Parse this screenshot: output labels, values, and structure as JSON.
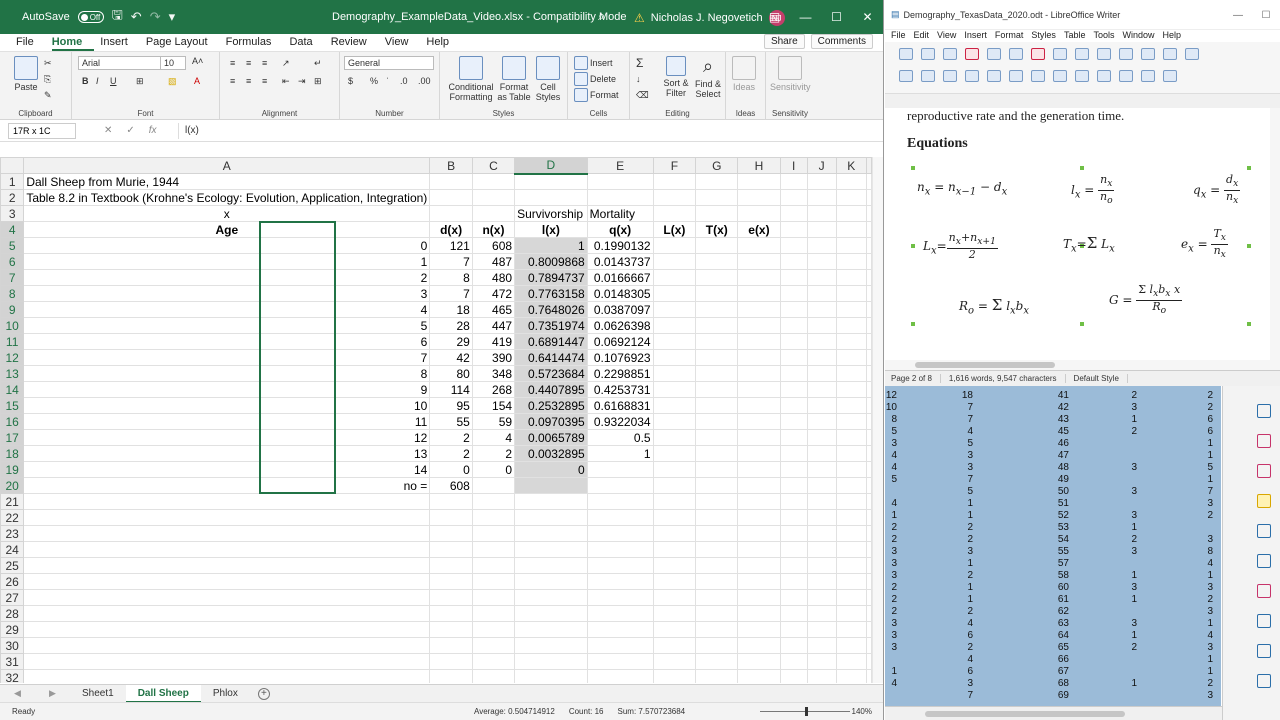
{
  "excel": {
    "autosave_label": "AutoSave",
    "autosave_state": "Off",
    "title": "Demography_ExampleData_Video.xlsx  -  Compatibility Mode",
    "user": "Nicholas J. Negovetich",
    "user_initials": "NJ",
    "menu": [
      "File",
      "Home",
      "Insert",
      "Page Layout",
      "Formulas",
      "Data",
      "Review",
      "View",
      "Help"
    ],
    "active_tab": "Home",
    "share": "Share",
    "comments": "Comments",
    "ribbon": {
      "paste": "Paste",
      "clipboard": "Clipboard",
      "font_name": "Arial",
      "font_size": "10",
      "font": "Font",
      "alignment": "Alignment",
      "number_format": "General",
      "number": "Number",
      "conditional": "Conditional Formatting",
      "format_table": "Format as Table",
      "cell_styles": "Cell Styles",
      "styles": "Styles",
      "insert": "Insert",
      "delete": "Delete",
      "format": "Format",
      "cells": "Cells",
      "sort": "Sort & Filter",
      "find": "Find & Select",
      "editing": "Editing",
      "ideas_btn": "Ideas",
      "ideas": "Ideas",
      "sensitivity_btn": "Sensitivity",
      "sensitivity": "Sensitivity"
    },
    "name_box": "17R x 1C",
    "formula": "l(x)",
    "columns": [
      "A",
      "B",
      "C",
      "D",
      "E",
      "F",
      "G",
      "H",
      "I",
      "J",
      "K"
    ],
    "rows": [
      [
        "Dall Sheep from Murie, 1944",
        "",
        "",
        "",
        "",
        "",
        "",
        "",
        "",
        "",
        ""
      ],
      [
        "Table 8.2 in Textbook (Krohne's Ecology: Evolution, Application, Integration)",
        "",
        "",
        "",
        "",
        "",
        "",
        "",
        "",
        "",
        ""
      ],
      [
        "x",
        "",
        "",
        "Survivorship",
        "Mortality",
        "",
        "",
        "",
        "",
        "",
        ""
      ],
      [
        "Age",
        "d(x)",
        "n(x)",
        "l(x)",
        "q(x)",
        "L(x)",
        "T(x)",
        "e(x)",
        "",
        "",
        ""
      ],
      [
        "0",
        "121",
        "608",
        "1",
        "0.1990132",
        "",
        "",
        "",
        "",
        "",
        ""
      ],
      [
        "1",
        "7",
        "487",
        "0.8009868",
        "0.0143737",
        "",
        "",
        "",
        "",
        "",
        ""
      ],
      [
        "2",
        "8",
        "480",
        "0.7894737",
        "0.0166667",
        "",
        "",
        "",
        "",
        "",
        ""
      ],
      [
        "3",
        "7",
        "472",
        "0.7763158",
        "0.0148305",
        "",
        "",
        "",
        "",
        "",
        ""
      ],
      [
        "4",
        "18",
        "465",
        "0.7648026",
        "0.0387097",
        "",
        "",
        "",
        "",
        "",
        ""
      ],
      [
        "5",
        "28",
        "447",
        "0.7351974",
        "0.0626398",
        "",
        "",
        "",
        "",
        "",
        ""
      ],
      [
        "6",
        "29",
        "419",
        "0.6891447",
        "0.0692124",
        "",
        "",
        "",
        "",
        "",
        ""
      ],
      [
        "7",
        "42",
        "390",
        "0.6414474",
        "0.1076923",
        "",
        "",
        "",
        "",
        "",
        ""
      ],
      [
        "8",
        "80",
        "348",
        "0.5723684",
        "0.2298851",
        "",
        "",
        "",
        "",
        "",
        ""
      ],
      [
        "9",
        "114",
        "268",
        "0.4407895",
        "0.4253731",
        "",
        "",
        "",
        "",
        "",
        ""
      ],
      [
        "10",
        "95",
        "154",
        "0.2532895",
        "0.6168831",
        "",
        "",
        "",
        "",
        "",
        ""
      ],
      [
        "11",
        "55",
        "59",
        "0.0970395",
        "0.9322034",
        "",
        "",
        "",
        "",
        "",
        ""
      ],
      [
        "12",
        "2",
        "4",
        "0.0065789",
        "0.5",
        "",
        "",
        "",
        "",
        "",
        ""
      ],
      [
        "13",
        "2",
        "2",
        "0.0032895",
        "1",
        "",
        "",
        "",
        "",
        "",
        ""
      ],
      [
        "14",
        "0",
        "0",
        "0",
        "",
        "",
        "",
        "",
        "",
        "",
        ""
      ],
      [
        "no =",
        "608",
        "",
        "",
        "",
        "",
        "",
        "",
        "",
        "",
        ""
      ]
    ],
    "total_rows": 32,
    "sheet_tabs": [
      "Sheet1",
      "Dall Sheep",
      "Phlox"
    ],
    "active_sheet": "Dall Sheep",
    "status": {
      "ready": "Ready",
      "average": "Average: 0.504714912",
      "count": "Count: 16",
      "sum": "Sum: 7.570723684",
      "zoom": "140%"
    }
  },
  "writer": {
    "title": "Demography_TexasData_2020.odt - LibreOffice Writer",
    "menu": [
      "File",
      "Edit",
      "View",
      "Insert",
      "Format",
      "Styles",
      "Table",
      "Tools",
      "Window",
      "Help"
    ],
    "cut_text": "reproductive rate and the generation time.",
    "heading": "Equations",
    "status": {
      "page": "Page 2 of 8",
      "words": "1,616 words, 9,547 characters",
      "style": "Default Style"
    }
  },
  "blue_data": [
    [
      "12",
      "18",
      "41",
      "2",
      "2"
    ],
    [
      "10",
      "7",
      "42",
      "3",
      "2"
    ],
    [
      "8",
      "7",
      "43",
      "1",
      "6"
    ],
    [
      "5",
      "4",
      "45",
      "2",
      "6"
    ],
    [
      "3",
      "5",
      "46",
      "",
      "1"
    ],
    [
      "4",
      "3",
      "47",
      "",
      "1"
    ],
    [
      "4",
      "3",
      "48",
      "3",
      "5"
    ],
    [
      "5",
      "7",
      "49",
      "",
      "1"
    ],
    [
      "",
      "5",
      "50",
      "3",
      "7"
    ],
    [
      "4",
      "1",
      "51",
      "",
      "3"
    ],
    [
      "1",
      "1",
      "52",
      "3",
      "2"
    ],
    [
      "2",
      "2",
      "53",
      "1",
      ""
    ],
    [
      "2",
      "2",
      "54",
      "2",
      "3"
    ],
    [
      "3",
      "3",
      "55",
      "3",
      "8"
    ],
    [
      "3",
      "1",
      "57",
      "",
      "4"
    ],
    [
      "3",
      "2",
      "58",
      "1",
      "1"
    ],
    [
      "2",
      "1",
      "60",
      "3",
      "3"
    ],
    [
      "2",
      "1",
      "61",
      "1",
      "2"
    ],
    [
      "2",
      "2",
      "62",
      "",
      "3"
    ],
    [
      "3",
      "4",
      "63",
      "3",
      "1"
    ],
    [
      "3",
      "6",
      "64",
      "1",
      "4"
    ],
    [
      "3",
      "2",
      "65",
      "2",
      "3"
    ],
    [
      "",
      "4",
      "66",
      "",
      "1"
    ],
    [
      "1",
      "6",
      "67",
      "",
      "1"
    ],
    [
      "4",
      "3",
      "68",
      "1",
      "2"
    ],
    [
      "",
      "7",
      "69",
      "",
      "3"
    ]
  ]
}
